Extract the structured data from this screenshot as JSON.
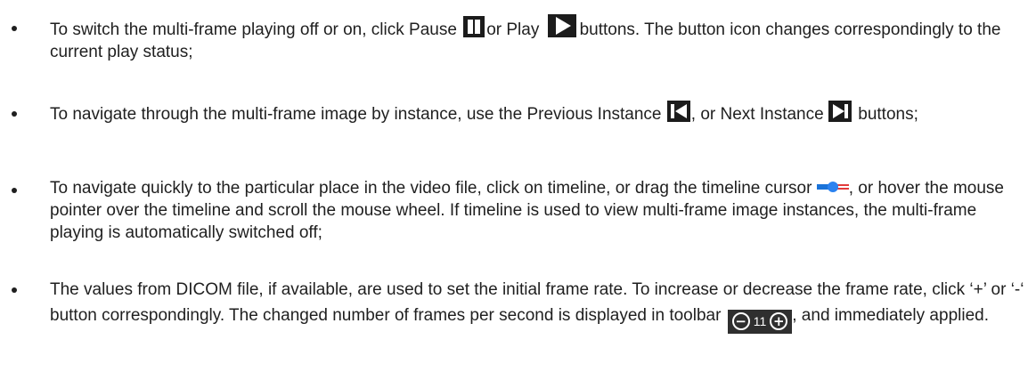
{
  "items": [
    {
      "segments": [
        "To switch the multi-frame playing off or on, click Pause",
        "or Play",
        "buttons. The button icon changes correspondingly to the current play status;"
      ],
      "icons": [
        "pause-icon",
        "play-icon"
      ]
    },
    {
      "segments": [
        "To navigate through the multi-frame image by instance, use the Previous Instance",
        ", or Next Instance",
        "buttons;"
      ],
      "icons": [
        "previous-instance-icon",
        "next-instance-icon"
      ]
    },
    {
      "segments": [
        "To navigate quickly to the particular place in the video file, click on timeline, or drag the timeline cursor",
        ", or hover the mouse pointer over the timeline and scroll the mouse wheel. If timeline is used to view multi-frame image instances, the multi-frame playing is automatically switched off;"
      ],
      "icons": [
        "timeline-cursor-icon"
      ]
    },
    {
      "segments": [
        "The values from DICOM file, if available, are used to set the initial frame rate. To increase or decrease the frame rate, click ‘+’ or ‘-‘ button correspondingly. The changed number of frames per second is displayed in toolbar",
        ", and immediately applied."
      ],
      "icons": [
        "frame-rate-toolbar"
      ],
      "toolbar": {
        "value": "11",
        "minus": "−",
        "plus": "+"
      }
    }
  ],
  "colors": {
    "text": "#1f1f1f",
    "icon_bg": "#1c1c1c",
    "timeline_blue": "#1a73d9",
    "timeline_red": "#e23b3b",
    "toolbar_bg": "#2f2f2f"
  }
}
